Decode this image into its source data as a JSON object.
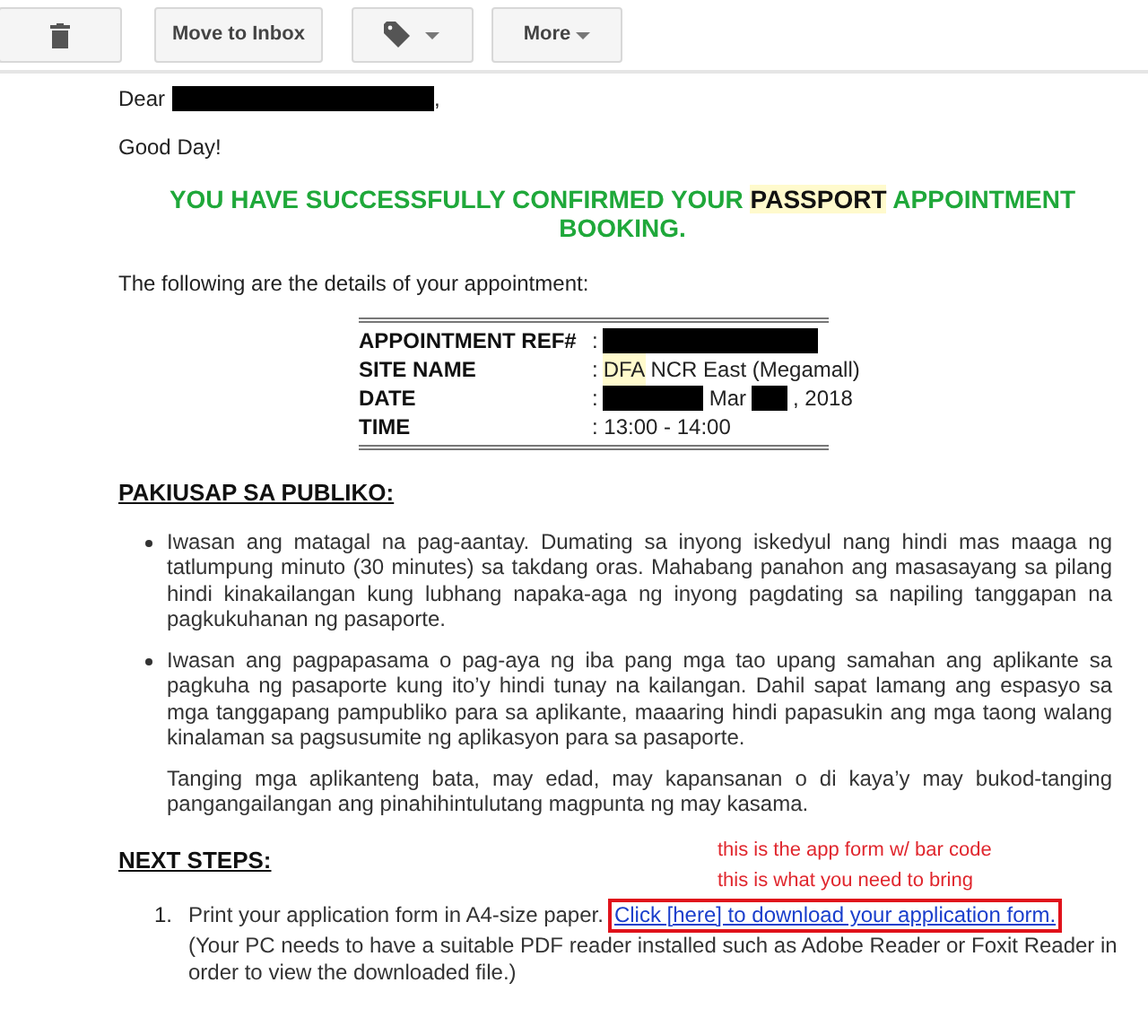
{
  "toolbar": {
    "buttons": [
      {
        "kind": "delete"
      },
      {
        "kind": "text",
        "label": "Move to Inbox"
      },
      {
        "kind": "label-menu"
      },
      {
        "kind": "menu",
        "label": "More"
      }
    ]
  },
  "greeting": [
    {
      "kind": "text",
      "text": "Dear"
    },
    {
      "kind": "redacted"
    },
    {
      "kind": "text",
      "text": ","
    }
  ],
  "salutation": "Good Day!",
  "headline": [
    {
      "text": "YOU HAVE SUCCESSFULLY CONFIRMED YOUR ",
      "highlighted": false
    },
    {
      "text": "PASSPORT",
      "highlighted": true
    },
    {
      "text": " APPOINTMENT BOOKING.",
      "highlighted": false
    }
  ],
  "intro": "The following are the details of your appointment:",
  "details": [
    {
      "label": "APPOINTMENT REF#",
      "value": [
        {
          "kind": "text",
          "text": ":"
        },
        {
          "kind": "redacted_long"
        }
      ]
    },
    {
      "label": "SITE NAME",
      "value": [
        {
          "kind": "text",
          "text": ":"
        },
        {
          "kind": "highlight",
          "text": "DFA"
        },
        {
          "kind": "text",
          "text": "NCR East (Megamall)"
        }
      ]
    },
    {
      "label": "DATE",
      "value": [
        {
          "kind": "text",
          "text": ":"
        },
        {
          "kind": "redacted_medium"
        },
        {
          "kind": "text",
          "text": "Mar"
        },
        {
          "kind": "redacted_short"
        },
        {
          "kind": "text",
          "text": ", 2018"
        }
      ]
    },
    {
      "label": "TIME",
      "value": [
        {
          "kind": "text",
          "text": ": 13:00 - 14:00"
        }
      ]
    }
  ],
  "notice": {
    "heading": "PAKIUSAP SA PUBLIKO:",
    "items": [
      {
        "paragraphs": [
          "Iwasan ang matagal na pag-aantay. Dumating sa inyong iskedyul nang hindi mas maaga ng tatlumpung minuto (30 minutes) sa takdang oras. Mahabang panahon ang masasayang sa pilang hindi kinakailangan kung lubhang napaka-aga ng inyong pagdating sa napiling tanggapan na pagkukuhanan ng pasaporte."
        ]
      },
      {
        "paragraphs": [
          "Iwasan ang pagpapasama o pag-aya ng iba pang mga tao upang samahan ang aplikante sa pagkuha ng pasaporte kung ito’y hindi tunay na kailangan. Dahil sapat lamang ang espasyo sa mga tanggapang pampubliko para sa aplikante, maaaring hindi papasukin ang mga taong walang kinalaman sa pagsusumite ng aplikasyon para sa pasaporte.",
          "Tanging mga aplikanteng bata, may edad, may kapansanan o di kaya’y may bukod-tanging pangangailangan ang pinahihintulutang magpunta ng may kasama."
        ]
      }
    ]
  },
  "next_steps": {
    "heading": "NEXT STEPS:",
    "annotations": [
      "this is the app form w/ bar code",
      "this is what you need to bring"
    ],
    "steps": [
      {
        "number": "1.",
        "text": "Print your application form in A4-size paper.",
        "link": "Click [here] to download your application form.",
        "note": "(Your PC needs to have a suitable PDF reader installed such as Adobe Reader or Foxit Reader in order to view the downloaded file.)"
      }
    ]
  }
}
